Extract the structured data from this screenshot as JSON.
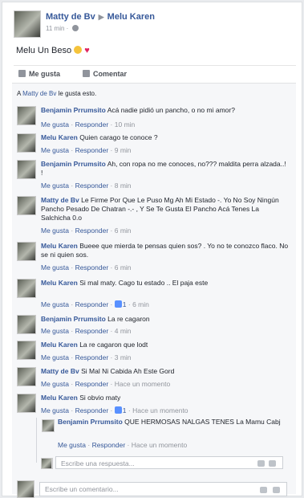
{
  "post": {
    "author": "Matty de Bv",
    "arrow": "▶",
    "recipient": "Melu Karen",
    "time": "11 min",
    "dot": "·",
    "text": "Melu Un Beso",
    "heart": "♥"
  },
  "actions": {
    "like": "Me gusta",
    "comment": "Comentar"
  },
  "likes_line": {
    "prefix": "A",
    "name": "Matty de Bv",
    "suffix": "le gusta esto."
  },
  "labels": {
    "like": "Me gusta",
    "reply": "Responder",
    "sep": "·"
  },
  "comments": [
    {
      "author": "Benjamin Prrumsito",
      "text": "Acá nadie pidió un pancho, o no mi amor?",
      "time": "10 min",
      "likes": ""
    },
    {
      "author": "Melu Karen",
      "text": "Quien carago te conoce ?",
      "time": "9 min",
      "likes": ""
    },
    {
      "author": "Benjamin Prrumsito",
      "text": "Ah, con ropa no me conoces, no??? maldita perra alzada..! !",
      "time": "8 min",
      "likes": ""
    },
    {
      "author": "Matty de Bv",
      "text": "Le Firme Por Que Le Puso Mg Ah Mi Estado -. Yo No Soy Ningún Pancho Pesado De Chatran -.- , Y Se Te Gusta El Pancho Acá Tenes La Salchicha 0.o",
      "time": "6 min",
      "likes": ""
    },
    {
      "author": "Melu Karen",
      "text": "Bueee que mierda te pensas quien sos? . Yo no te conozco flaco. No se ni quien sos.",
      "time": "6 min",
      "likes": ""
    },
    {
      "author": "Melu Karen",
      "text": "Si mal maty. Cago tu estado .. El paja este",
      "time": "6 min",
      "likes": "1"
    },
    {
      "author": "Benjamin Prrumsito",
      "text": "La re cagaron",
      "time": "4 min",
      "likes": ""
    },
    {
      "author": "Melu Karen",
      "text": "La re cagaron que lodt",
      "time": "3 min",
      "likes": ""
    },
    {
      "author": "Matty de Bv",
      "text": "Si Mal Ni Cabida Ah Este Gord",
      "time": "Hace un momento",
      "likes": ""
    },
    {
      "author": "Melu Karen",
      "text": "Si obvio maty",
      "time": "Hace un momento",
      "likes": "1"
    }
  ],
  "reply": {
    "author": "Benjamin Prrumsito",
    "text": "QUE HERMOSAS NALGAS TENES La Mamu Cabj",
    "time": "Hace un momento"
  },
  "reply_input": {
    "placeholder": "Escribe una respuesta..."
  },
  "comment_input": {
    "placeholder": "Escribe un comentario..."
  }
}
